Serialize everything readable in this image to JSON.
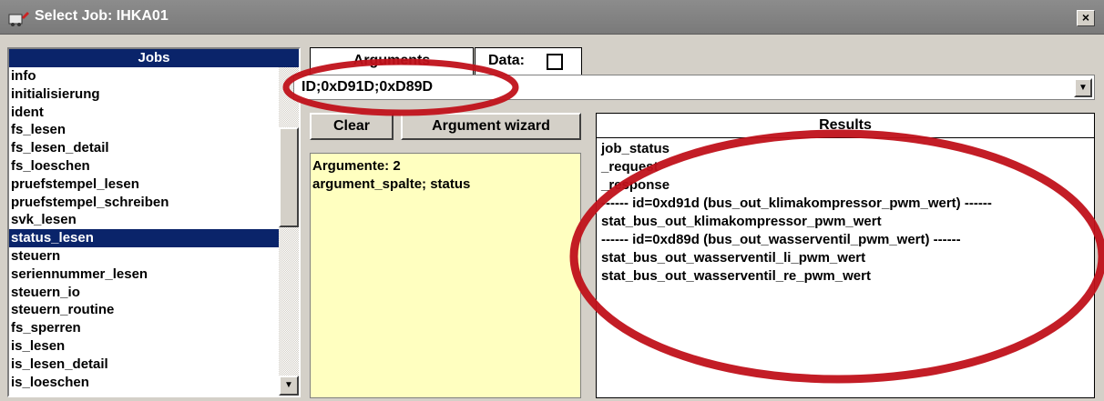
{
  "window": {
    "title": "Select Job: IHKA01",
    "close_label": "×"
  },
  "jobs": {
    "header": "Jobs",
    "items": [
      "info",
      "initialisierung",
      "ident",
      "fs_lesen",
      "fs_lesen_detail",
      "fs_loeschen",
      "pruefstempel_lesen",
      "pruefstempel_schreiben",
      "svk_lesen",
      "status_lesen",
      "steuern",
      "seriennummer_lesen",
      "steuern_io",
      "steuern_routine",
      "fs_sperren",
      "is_lesen",
      "is_lesen_detail",
      "is_loeschen"
    ],
    "selected": "status_lesen"
  },
  "tabs": {
    "arguments_label": "Arguments",
    "data_label": "Data:"
  },
  "argument": {
    "value": "ID;0xD91D;0xD89D"
  },
  "buttons": {
    "clear_label": "Clear",
    "wizard_label": "Argument wizard"
  },
  "arg_info": {
    "line1": "Argumente:  2",
    "line2": "argument_spalte; status"
  },
  "results": {
    "header": "Results",
    "items": [
      "job_status",
      "_request",
      "_response",
      "------ id=0xd91d (bus_out_klimakompressor_pwm_wert) ------",
      "stat_bus_out_klimakompressor_pwm_wert",
      "------ id=0xd89d (bus_out_wasserventil_pwm_wert) ------",
      "stat_bus_out_wasserventil_li_pwm_wert",
      "stat_bus_out_wasserventil_re_pwm_wert"
    ]
  },
  "colors": {
    "selection": "#0a246a",
    "annotation": "#c0111a",
    "arg_info_bg": "#ffffc0"
  }
}
